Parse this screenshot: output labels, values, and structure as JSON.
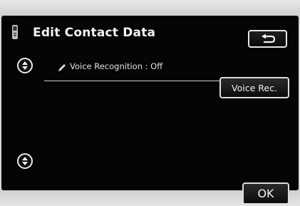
{
  "screen": {
    "title": "Edit Contact Data",
    "title_icon": "phone-icon",
    "back_icon": "return-arrow-icon"
  },
  "list": {
    "rows": [
      {
        "label": "Voice Recognition : Off",
        "icon": "pencil-icon"
      }
    ],
    "scroll_up_icon": "scroll-up-icon",
    "scroll_down_icon": "scroll-down-icon"
  },
  "buttons": {
    "voice_rec_label": "Voice Rec.",
    "ok_label": "OK"
  },
  "colors": {
    "screen_background": "#050505",
    "text": "#f2f2f2",
    "button_border": "#dcdcdc"
  }
}
